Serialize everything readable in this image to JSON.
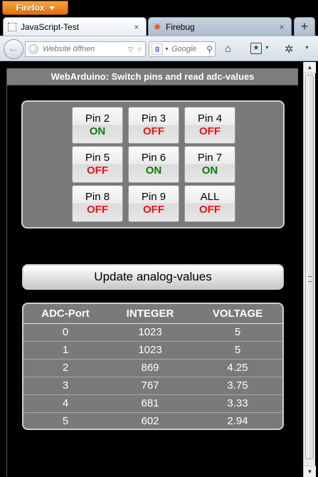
{
  "browser": {
    "menu_button": "Firefox",
    "tabs": [
      {
        "title": "JavaScript-Test",
        "close": "×"
      },
      {
        "title": "Firebug",
        "close": "×"
      }
    ],
    "new_tab": "+",
    "url_placeholder": "Website öffnen",
    "search_placeholder": "Google",
    "search_engine_icon": "google-icon",
    "back_glyph": "←"
  },
  "page": {
    "title": "WebArduino: Switch pins and read adc-values",
    "pins": [
      {
        "label": "Pin 2",
        "state": "ON"
      },
      {
        "label": "Pin 3",
        "state": "OFF"
      },
      {
        "label": "Pin 4",
        "state": "OFF"
      },
      {
        "label": "Pin 5",
        "state": "OFF"
      },
      {
        "label": "Pin 6",
        "state": "ON"
      },
      {
        "label": "Pin 7",
        "state": "ON"
      },
      {
        "label": "Pin 8",
        "state": "OFF"
      },
      {
        "label": "Pin 9",
        "state": "OFF"
      },
      {
        "label": "ALL",
        "state": "OFF"
      }
    ],
    "update_button": "Update analog-values",
    "table": {
      "headers": [
        "ADC-Port",
        "INTEGER",
        "VOLTAGE"
      ],
      "rows": [
        [
          "0",
          "1023",
          "5"
        ],
        [
          "1",
          "1023",
          "5"
        ],
        [
          "2",
          "869",
          "4.25"
        ],
        [
          "3",
          "767",
          "3.75"
        ],
        [
          "4",
          "681",
          "3.33"
        ],
        [
          "5",
          "602",
          "2.94"
        ]
      ]
    }
  },
  "colors": {
    "on": "#0b7a0b",
    "off": "#ee1111",
    "panel": "#7a7a7a",
    "firefox_orange": "#e0720e"
  }
}
